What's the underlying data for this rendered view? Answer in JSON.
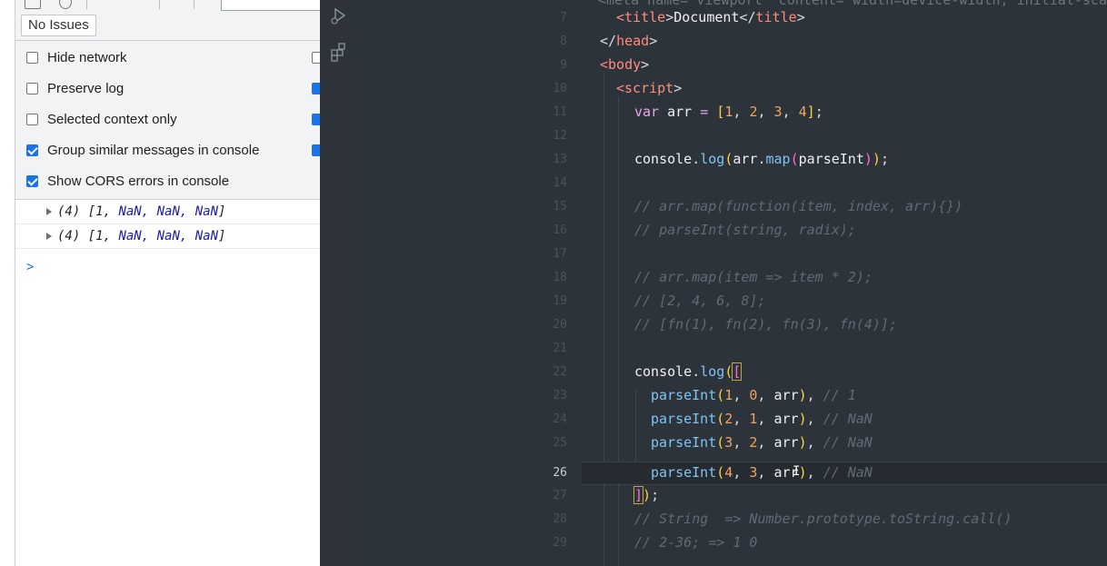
{
  "devtools": {
    "issues_button": "No Issues",
    "settings": [
      {
        "label": "Hide network",
        "checked": false,
        "right_checked": false
      },
      {
        "label": "Preserve log",
        "checked": false,
        "right_checked": true
      },
      {
        "label": "Selected context only",
        "checked": false,
        "right_checked": true
      },
      {
        "label": "Group similar messages in console",
        "checked": true,
        "right_checked": true
      },
      {
        "label": "Show CORS errors in console",
        "checked": true,
        "right_checked": null
      }
    ],
    "console_output": [
      {
        "prefix": "(4) [1, ",
        "values": "NaN, NaN, NaN",
        "suffix": "]"
      },
      {
        "prefix": "(4) [1, ",
        "values": "NaN, NaN, NaN",
        "suffix": "]"
      }
    ],
    "prompt_symbol": ">",
    "accent_color": "#1a73e8"
  },
  "activity_bar": {
    "icons": [
      "run-debug-icon",
      "extensions-icon"
    ]
  },
  "editor": {
    "active_line": "26",
    "lines": [
      {
        "n": "7",
        "text": "<title>Document</title>"
      },
      {
        "n": "8",
        "text": "</head>"
      },
      {
        "n": "9",
        "text": "<body>"
      },
      {
        "n": "10",
        "text": "<script>"
      },
      {
        "n": "11",
        "text": "var arr = [1, 2, 3, 4];"
      },
      {
        "n": "12",
        "text": ""
      },
      {
        "n": "13",
        "text": "console.log(arr.map(parseInt));"
      },
      {
        "n": "14",
        "text": ""
      },
      {
        "n": "15",
        "text": "// arr.map(function(item, index, arr){})"
      },
      {
        "n": "16",
        "text": "// parseInt(string, radix);"
      },
      {
        "n": "17",
        "text": ""
      },
      {
        "n": "18",
        "text": "// arr.map(item => item * 2);"
      },
      {
        "n": "19",
        "text": "// [2, 4, 6, 8];"
      },
      {
        "n": "20",
        "text": "// [fn(1), fn(2), fn(3), fn(4)];"
      },
      {
        "n": "21",
        "text": ""
      },
      {
        "n": "22",
        "text": "console.log(["
      },
      {
        "n": "23",
        "text": "parseInt(1, 0, arr), // 1"
      },
      {
        "n": "24",
        "text": "parseInt(2, 1, arr), // NaN"
      },
      {
        "n": "25",
        "text": "parseInt(3, 2, arr), // NaN"
      },
      {
        "n": "26",
        "text": "parseInt(4, 3, arr), // NaN"
      },
      {
        "n": "27",
        "text": "]);"
      },
      {
        "n": "28",
        "text": "// String  => Number.prototype.toString.call()"
      },
      {
        "n": "29",
        "text": "// 2-36; => 1 0"
      }
    ]
  }
}
